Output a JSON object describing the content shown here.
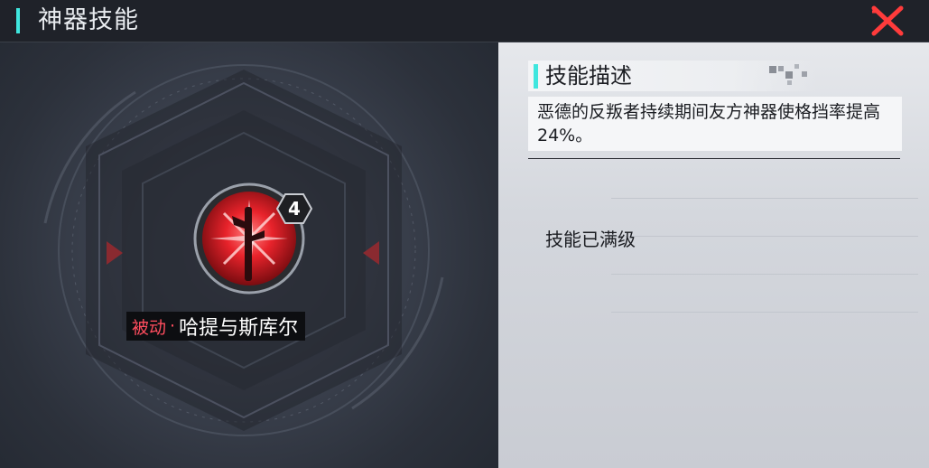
{
  "header": {
    "title": "神器技能",
    "accent_color": "#3fe6de",
    "close_icon": "close-x-icon",
    "close_color": "#ff3b3b"
  },
  "skill": {
    "level": "4",
    "type_label": "被动",
    "separator": "·",
    "name": "哈提与斯库尔",
    "type_color": "#ff4d5e"
  },
  "description": {
    "title": "技能描述",
    "text": "恶德的反叛者持续期间友方神器使格挡率提高24%。",
    "status": "技能已满级"
  }
}
